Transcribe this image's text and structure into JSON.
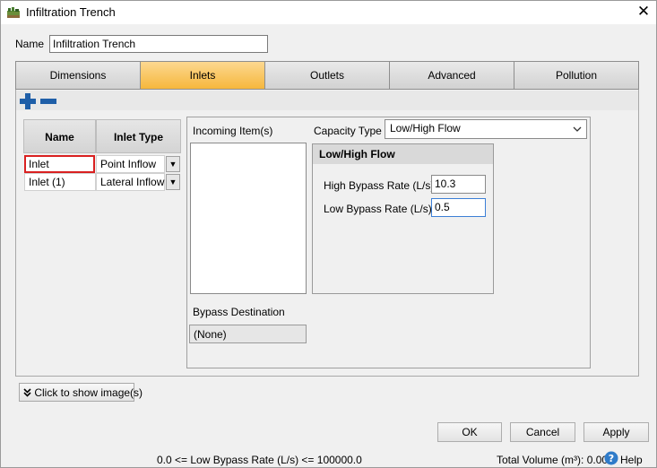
{
  "window": {
    "title": "Infiltration Trench",
    "close_glyph": "✕"
  },
  "name_field": {
    "label": "Name",
    "value": "Infiltration Trench"
  },
  "tabs": [
    {
      "label": "Dimensions",
      "active": false
    },
    {
      "label": "Inlets",
      "active": true
    },
    {
      "label": "Outlets",
      "active": false
    },
    {
      "label": "Advanced",
      "active": false
    },
    {
      "label": "Pollution",
      "active": false
    }
  ],
  "inlets_grid": {
    "headers": [
      "Name",
      "Inlet Type"
    ],
    "rows": [
      {
        "name": "Inlet",
        "type": "Point Inflow"
      },
      {
        "name": "Inlet (1)",
        "type": "Lateral Inflow"
      }
    ]
  },
  "incoming": {
    "label": "Incoming Item(s)"
  },
  "capacity": {
    "label": "Capacity Type",
    "value": "Low/High Flow"
  },
  "low_high": {
    "title": "Low/High Flow",
    "high_label": "High Bypass Rate (L/s)",
    "high_value": "10.3",
    "low_label": "Low Bypass Rate (L/s)",
    "low_value": "0.5"
  },
  "bypass": {
    "label": "Bypass Destination",
    "value": "(None)"
  },
  "show_image": {
    "label": "Click to show image(s)"
  },
  "buttons": {
    "ok": "OK",
    "cancel": "Cancel",
    "apply": "Apply"
  },
  "status": {
    "constraint": "0.0 <= Low Bypass Rate (L/s) <= 100000.0",
    "total_volume": "Total Volume (m³): 0.000",
    "help": "Help"
  },
  "icons": {
    "add": "plus-icon",
    "remove": "minus-icon",
    "dropdown": "chevron-down-icon",
    "help": "help-icon",
    "expand": "double-chevron-down-icon"
  },
  "colors": {
    "active_tab": "#f6b73c",
    "selected_cell_border": "#d92020",
    "add_remove": "#1f5fa8",
    "focus_border": "#3c7fd6"
  }
}
